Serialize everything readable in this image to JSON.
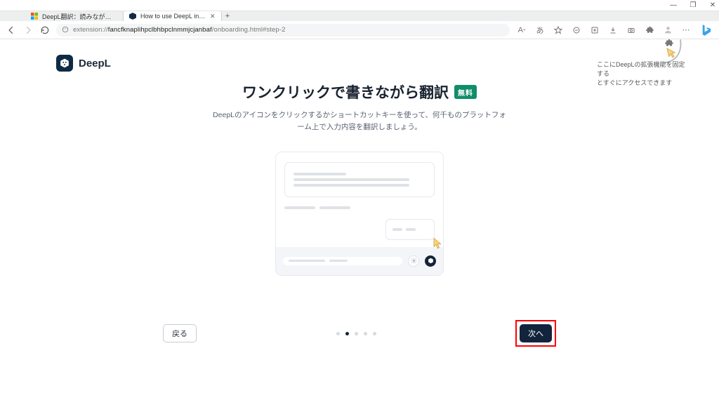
{
  "window": {
    "minimize": "—",
    "maximize": "❐",
    "close": "✕"
  },
  "tabs": {
    "items": [
      {
        "label": "DeepL翻訳：読みながら、書きなが",
        "active": false,
        "fav": "ms"
      },
      {
        "label": "How to use DeepL in Chrome",
        "active": true,
        "fav": "deepl"
      }
    ],
    "new": "+"
  },
  "address": {
    "scheme": "extension://",
    "host": "fancfknaplihpclbhbpclnmmjcjanbaf",
    "path": "/onboarding.html#step-2"
  },
  "logo": {
    "text": "DeepL"
  },
  "hint": {
    "line1": "ここにDeepLの拡張機能を固定する",
    "line2": "とすぐにアクセスできます"
  },
  "headline": {
    "title": "ワンクリックで書きながら翻訳",
    "badge": "無料"
  },
  "subtitle": "DeepLのアイコンをクリックするかショートカットキーを使って、何千ものプラットフォーム上で入力内容を翻訳しましょう。",
  "controls": {
    "back": "戻る",
    "next": "次へ",
    "step_active_index": 1,
    "step_count": 5
  }
}
